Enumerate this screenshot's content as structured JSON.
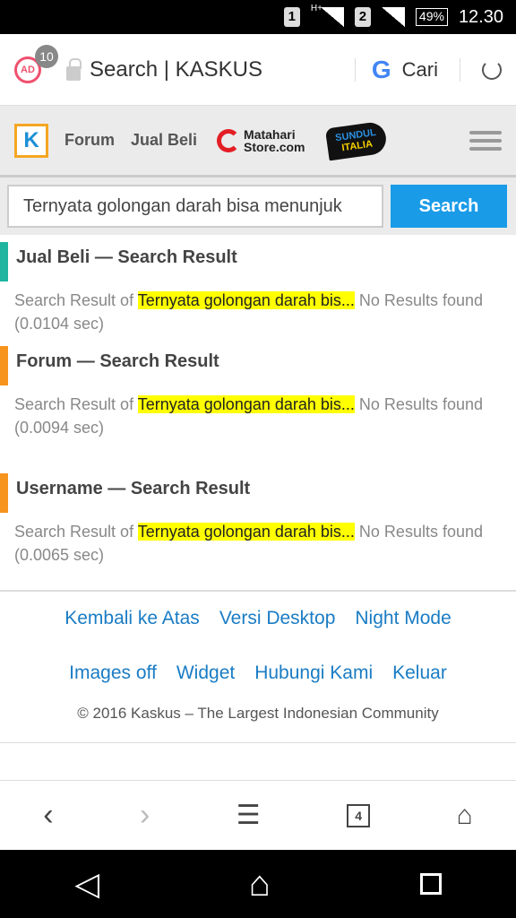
{
  "status": {
    "sim1": "1",
    "network": "H+",
    "sim2": "2",
    "battery": "49%",
    "time": "12.30"
  },
  "urlbar": {
    "ad_badge": "10",
    "ad_icon_text": "AD",
    "title": "Search | KASKUS",
    "google": "G",
    "search_label": "Cari"
  },
  "nav": {
    "logo": "K",
    "links": [
      "Forum",
      "Jual Beli"
    ],
    "matahari": [
      "Matahari",
      "Store.com"
    ],
    "bundul": [
      "SUNDUL",
      "ITALIA"
    ]
  },
  "search": {
    "value": "Ternyata golongan darah bisa menunjuk",
    "button": "Search"
  },
  "sections": [
    {
      "title": "Jual Beli — Search Result",
      "prefix": "Search Result of ",
      "query": "Ternyata golongan darah bis...",
      "suffix": " No Results found (0.0104 sec)",
      "color": "#1fb59e"
    },
    {
      "title": "Forum — Search Result",
      "prefix": "Search Result of ",
      "query": "Ternyata golongan darah bis...",
      "suffix": " No Results found (0.0094 sec)",
      "color": "#f7941d"
    },
    {
      "title": "Username — Search Result",
      "prefix": "Search Result of ",
      "query": "Ternyata golongan darah bis...",
      "suffix": "  No Results found (0.0065 sec)",
      "color": "#f7941d"
    }
  ],
  "footer": {
    "row1": [
      "Kembali ke Atas",
      "Versi Desktop",
      "Night Mode"
    ],
    "row2": [
      "Images off",
      "Widget",
      "Hubungi Kami",
      "Keluar"
    ],
    "copyright": "© 2016 Kaskus – The Largest Indonesian Community"
  },
  "browser": {
    "tab_count": "4"
  }
}
